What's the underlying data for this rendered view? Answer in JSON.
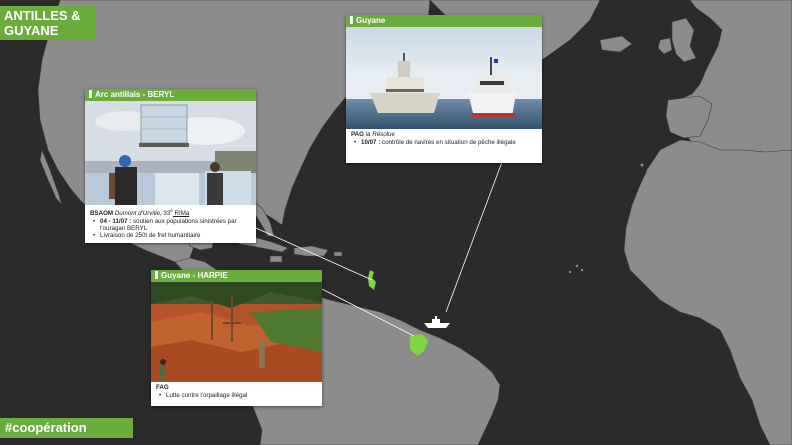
{
  "title": {
    "line1": "ANTILLES &",
    "line2": "GUYANE"
  },
  "hashtag": "#coopération",
  "cards": {
    "guyane": {
      "header": "Guyane",
      "unit_prefix": "PAG",
      "unit_name": "la Résolue",
      "bullets": [
        {
          "date": "10/07 :",
          "text": "contrôle de navires en situation de pêche illégale"
        }
      ]
    },
    "beryl": {
      "header": "Arc antillais - BERYL",
      "unit_prefix": "BSAOM",
      "unit_name": "Dumont d'Urville",
      "unit_suffix": ", 33",
      "unit_sup": "e",
      "unit_regiment": " RIMa",
      "bullets": [
        {
          "date": "04 - 11/07 :",
          "text": "soutien aux populations sinistrées par l'ouragan BERYL"
        },
        {
          "date": "",
          "text": "Livraison de 250t de fret humanitaire"
        }
      ]
    },
    "harpie": {
      "header": "Guyane - HARPIE",
      "unit_prefix": "FAG",
      "bullets": [
        {
          "date": "",
          "text": "Lutte contre l'orpaillage illégal"
        }
      ]
    }
  },
  "colors": {
    "accent": "#6aad3d",
    "land": "#8c8c8c",
    "sea": "#2b2b2b",
    "highlight": "#7fd63f"
  }
}
